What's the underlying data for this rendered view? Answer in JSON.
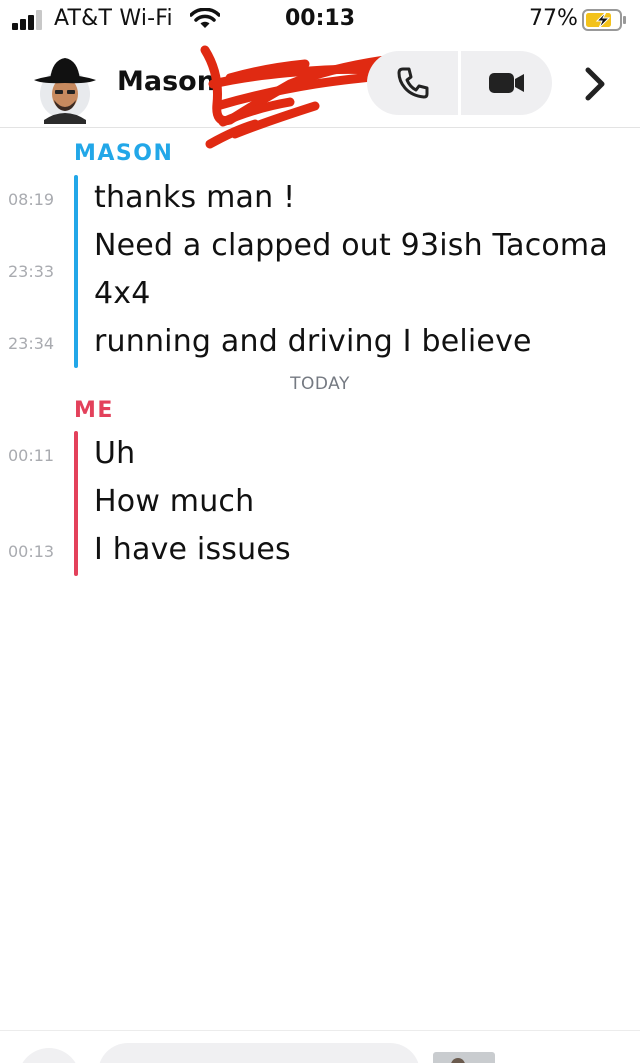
{
  "status_bar": {
    "carrier": "AT&T Wi-Fi",
    "time": "00:13",
    "battery": "77%",
    "battery_level": 0.77
  },
  "header": {
    "contact_name": "Mason",
    "call_icon": "phone-icon",
    "video_icon": "video-camera-icon",
    "more_icon": "chevron-right-icon"
  },
  "colors": {
    "friend": "#22a7e8",
    "me": "#e3415b",
    "scribble": "#e02a12",
    "timestamp": "#a9abb0"
  },
  "chat": {
    "groups": [
      {
        "sender": "MASON",
        "messages": [
          {
            "time": "08:19",
            "text": "thanks man !"
          },
          {
            "time": "",
            "text": "Need a clapped out 93ish Tacoma"
          },
          {
            "time": "23:33",
            "text": ""
          },
          {
            "time": "",
            "text": "4x4"
          },
          {
            "time": "23:34",
            "text": "running and driving I believe"
          }
        ]
      },
      {
        "separator": "TODAY"
      },
      {
        "sender": "ME",
        "messages": [
          {
            "time": "00:11",
            "text": "Uh"
          },
          {
            "time": "",
            "text": "How much"
          },
          {
            "time": "00:13",
            "text": "I have issues"
          }
        ]
      }
    ]
  }
}
